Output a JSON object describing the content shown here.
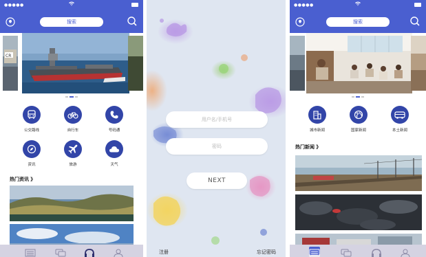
{
  "screens": {
    "home": {
      "search_label": "搜索",
      "grid": [
        {
          "label": "公交路线",
          "icon": "bus-icon"
        },
        {
          "label": "自行车",
          "icon": "bicycle-icon"
        },
        {
          "label": "号码通",
          "icon": "phone-icon"
        },
        {
          "label": "资讯",
          "icon": "compass-icon"
        },
        {
          "label": "旅游",
          "icon": "airplane-icon"
        },
        {
          "label": "天气",
          "icon": "cloud-icon"
        }
      ],
      "section_title": "热门资讯 》"
    },
    "login": {
      "username_placeholder": "用户名/手机号",
      "password_placeholder": "密码",
      "next_label": "NEXT",
      "register_label": "注册",
      "forgot_label": "忘记密码"
    },
    "news": {
      "search_label": "搜索",
      "grid": [
        {
          "label": "城市新闻",
          "icon": "building-icon"
        },
        {
          "label": "国家新闻",
          "icon": "globe-icon"
        },
        {
          "label": "本土新闻",
          "icon": "bus-icon"
        }
      ],
      "section_title": "热门新闻 》"
    }
  },
  "tabbar": [
    "list-icon",
    "chat-icon",
    "headphones-icon",
    "user-icon"
  ],
  "colors": {
    "primary": "#4a5fd0",
    "icon_circle": "#3245a8",
    "tabbar_bg": "#d5d3e2",
    "login_bg": "#dfe6f1"
  }
}
